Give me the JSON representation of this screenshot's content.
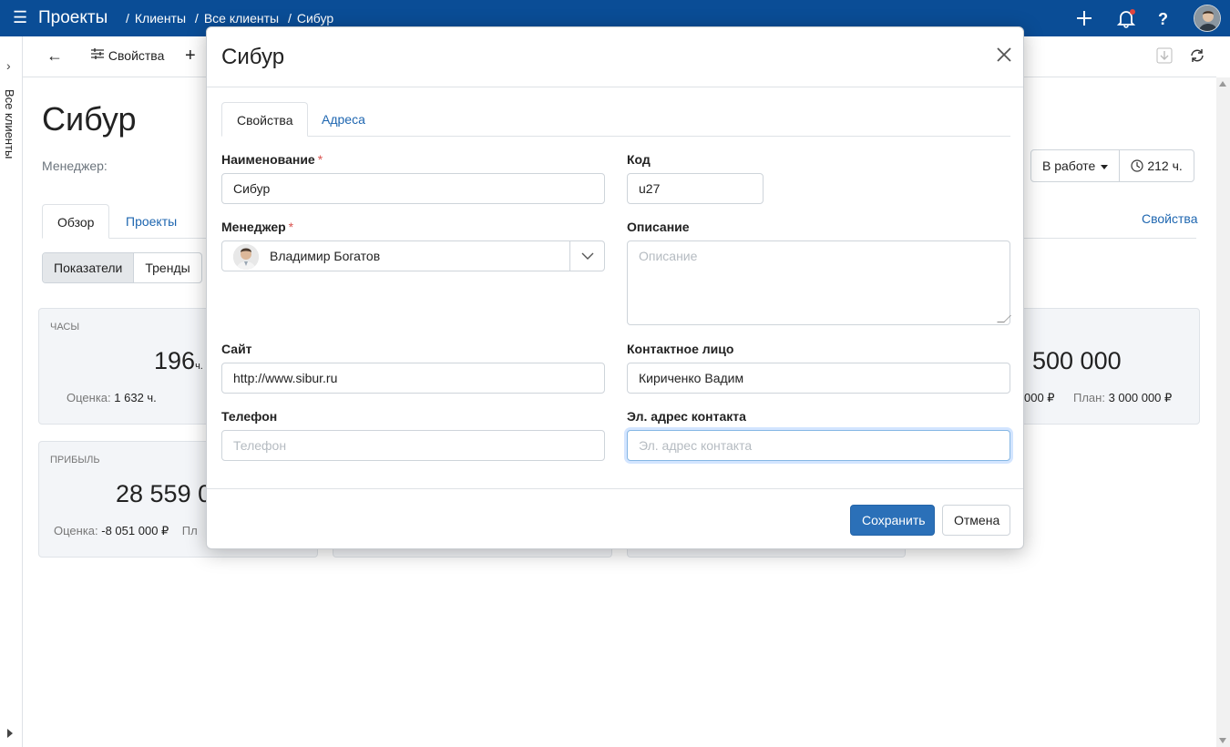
{
  "topbar": {
    "app_title": "Проекты",
    "breadcrumbs": [
      "Клиенты",
      "Все клиенты",
      "Сибур"
    ],
    "menu_icon": "menu-icon",
    "icons": [
      "plus-icon",
      "bell-icon",
      "help-icon"
    ],
    "help_glyph": "?"
  },
  "left_rail": {
    "label": "Все клиенты"
  },
  "toolbar": {
    "properties_label": "Свойства"
  },
  "background": {
    "title": "Сибур",
    "manager_label": "Менеджер:",
    "status": "В работе",
    "hours": "212 ч.",
    "tabs": [
      "Обзор",
      "Проекты"
    ],
    "properties_link": "Свойства",
    "segments": [
      "Показатели",
      "Тренды"
    ],
    "cards": {
      "hours": {
        "label": "Часы",
        "value": "196",
        "unit": "ч.",
        "estimate_label": "Оценка:",
        "estimate_value": "1 632 ч."
      },
      "revenue": {
        "value": "500 000",
        "left_tail": "000 ₽",
        "plan_label": "План:",
        "plan_value": "3 000 000 ₽"
      },
      "profit": {
        "label": "Прибыль",
        "value": "28 559 0",
        "estimate_label": "Оценка:",
        "estimate_value": "-8 051 000 ₽",
        "plan_tail": "Пл"
      }
    }
  },
  "modal": {
    "title": "Сибур",
    "tabs": [
      "Свойства",
      "Адреса"
    ],
    "fields": {
      "name": {
        "label": "Наименование",
        "value": "Сибур"
      },
      "code": {
        "label": "Код",
        "value": "u27"
      },
      "manager": {
        "label": "Менеджер",
        "value": "Владимир Богатов"
      },
      "description": {
        "label": "Описание",
        "placeholder": "Описание"
      },
      "site": {
        "label": "Сайт",
        "value": "http://www.sibur.ru"
      },
      "contact": {
        "label": "Контактное лицо",
        "value": "Кириченко Вадим"
      },
      "phone": {
        "label": "Телефон",
        "placeholder": "Телефон"
      },
      "email": {
        "label": "Эл. адрес контакта",
        "placeholder": "Эл. адрес контакта"
      }
    },
    "required_mark": "*",
    "save_label": "Сохранить",
    "cancel_label": "Отмена"
  }
}
